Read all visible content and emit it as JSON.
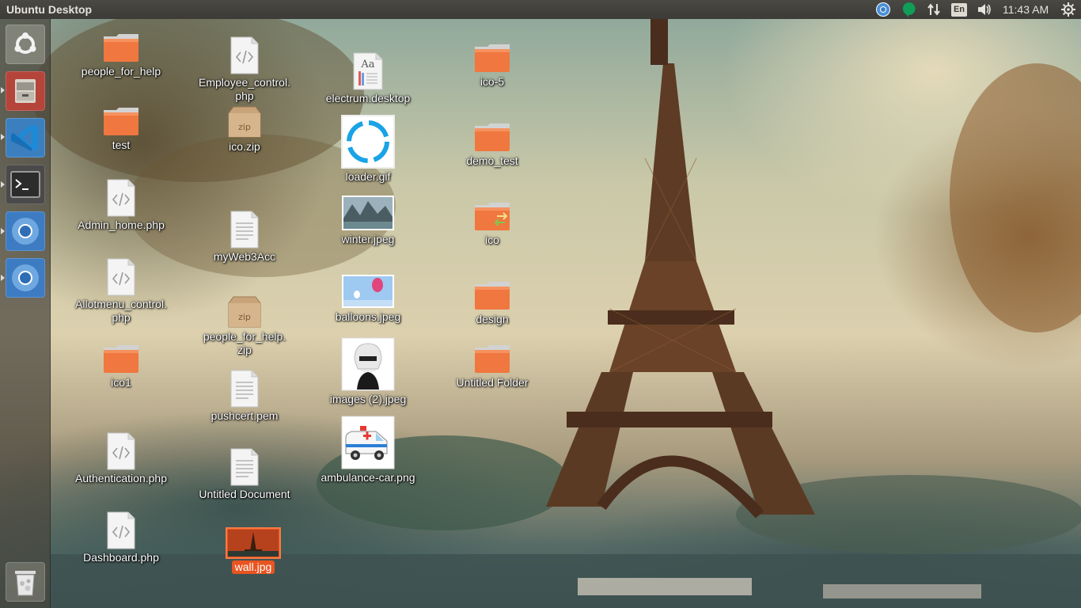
{
  "panel": {
    "title": "Ubuntu Desktop",
    "clock": "11:43 AM",
    "keyboard_layout": "En",
    "tray_icons": [
      "chrome-tray-icon",
      "hangouts-tray-icon",
      "network-icon",
      "keyboard-layout-icon",
      "volume-icon",
      "settings-gear-icon"
    ]
  },
  "launcher": {
    "items": [
      "ubuntu-dash",
      "files",
      "visual-studio-code",
      "terminal",
      "chromium",
      "chromium",
      "trash"
    ]
  },
  "desktop": {
    "icons": [
      {
        "label": "people_for_help",
        "type": "folder"
      },
      {
        "label": "test",
        "type": "folder"
      },
      {
        "label": "Admin_home.php",
        "type": "code"
      },
      {
        "label": "Allotmenu_control.\nphp",
        "type": "code"
      },
      {
        "label": "ico1",
        "type": "folder"
      },
      {
        "label": "Authentication.php",
        "type": "code"
      },
      {
        "label": "Dashboard.php",
        "type": "code"
      },
      {
        "label": "Employee_control.\nphp",
        "type": "code"
      },
      {
        "label": "ico.zip",
        "type": "zip"
      },
      {
        "label": "myWeb3Acc",
        "type": "text"
      },
      {
        "label": "people_for_help.\nzip",
        "type": "zip"
      },
      {
        "label": "pushcert.pem",
        "type": "text"
      },
      {
        "label": "Untitled Document",
        "type": "text"
      },
      {
        "label": "wall.jpg",
        "type": "image"
      },
      {
        "label": "electrum.desktop",
        "type": "font"
      },
      {
        "label": "loader.gif",
        "type": "image"
      },
      {
        "label": "winter.jpeg",
        "type": "image"
      },
      {
        "label": "balloons.jpeg",
        "type": "image"
      },
      {
        "label": "images (2).jpeg",
        "type": "image"
      },
      {
        "label": "ambulance-car.png",
        "type": "image"
      },
      {
        "label": "ico-5",
        "type": "folder"
      },
      {
        "label": "demo_test",
        "type": "folder"
      },
      {
        "label": "ico",
        "type": "folder"
      },
      {
        "label": "design",
        "type": "folder"
      },
      {
        "label": "Untitled Folder",
        "type": "folder"
      }
    ],
    "zip_badge": "zip",
    "font_preview": "Aa"
  },
  "colors": {
    "panel_bg": "#3c3b37",
    "folder_orange": "#f0773f",
    "selection_orange": "#e95420",
    "vscode_blue": "#1e8ad6",
    "chrome_blue": "#3b82c4"
  }
}
